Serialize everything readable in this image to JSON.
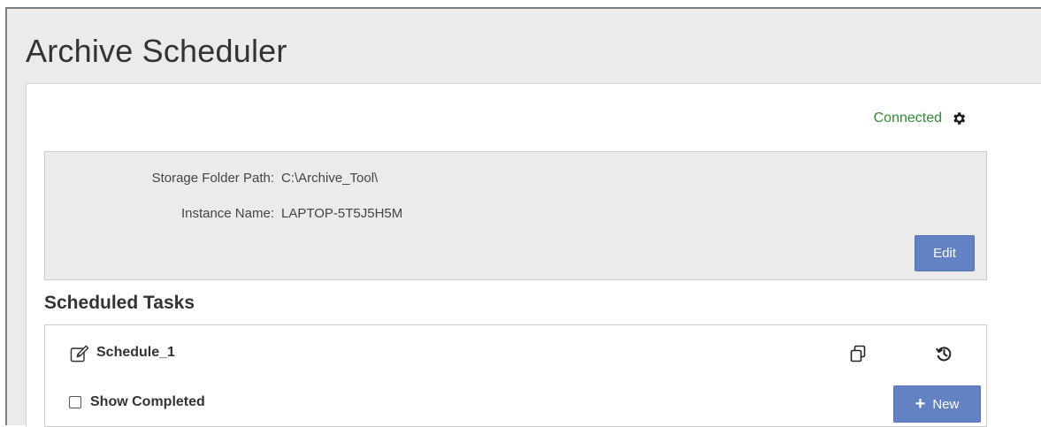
{
  "app": {
    "title": "Archive Scheduler"
  },
  "status": {
    "text": "Connected",
    "color": "#2f8a2f",
    "settings_icon": "gear-icon"
  },
  "settings": {
    "storage_folder_label": "Storage Folder Path:",
    "storage_folder_value": "C:\\Archive_Tool\\",
    "instance_name_label": "Instance Name:",
    "instance_name_value": "LAPTOP-5T5J5H5M",
    "edit_label": "Edit"
  },
  "tasks": {
    "section_title": "Scheduled Tasks",
    "items": [
      {
        "name": "Schedule_1",
        "icons": [
          "edit-icon",
          "copy-icon",
          "history-icon"
        ]
      }
    ],
    "show_completed_label": "Show Completed",
    "show_completed_checked": false,
    "new_label": "New",
    "new_icon": "plus-icon"
  },
  "colors": {
    "accent": "#6282c4",
    "header_bg": "#ebebeb",
    "panel_bg": "#ebebeb"
  }
}
